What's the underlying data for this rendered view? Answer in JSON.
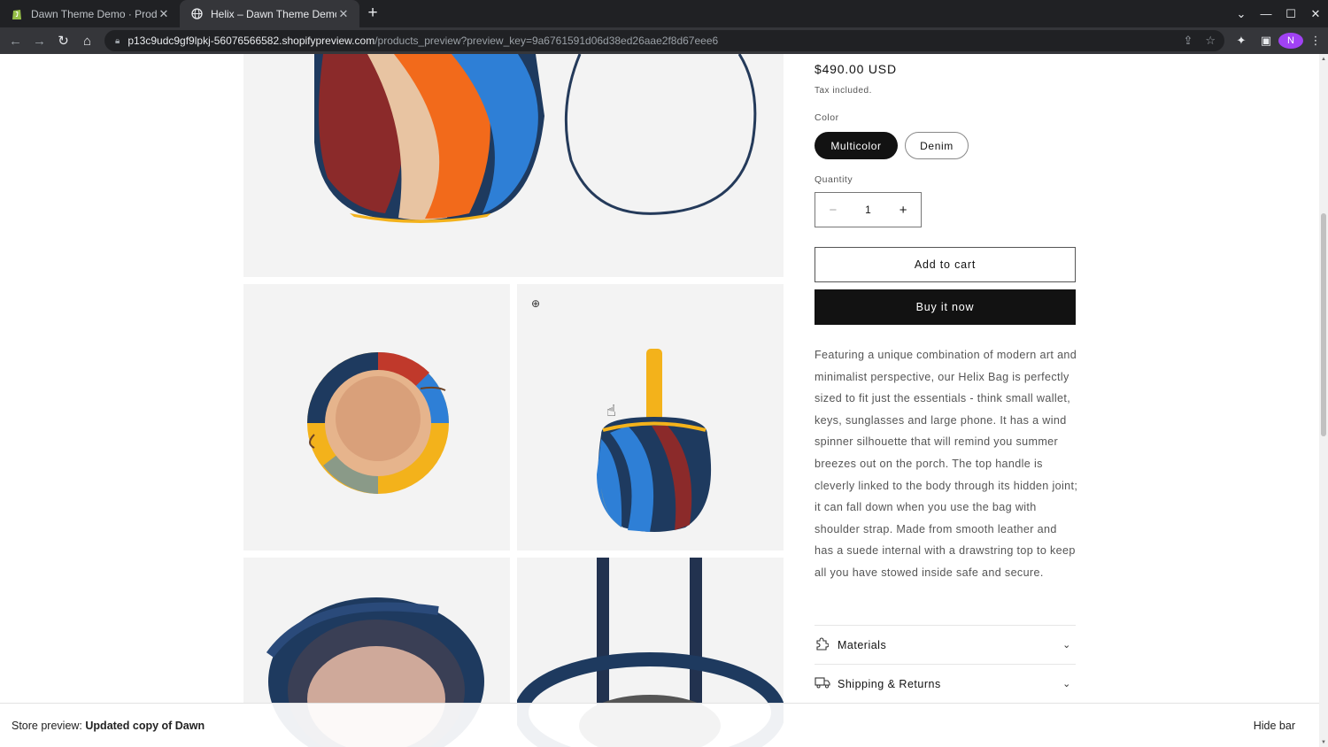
{
  "browser": {
    "tabs": [
      {
        "title": "Dawn Theme Demo · Product",
        "active": false,
        "favicon": "shopify-icon"
      },
      {
        "title": "Helix – Dawn Theme Demo",
        "active": true,
        "favicon": "globe-icon"
      }
    ],
    "url_host": "p13c9udc9gf9lpkj-56076566582.shopifypreview.com",
    "url_path": "/products_preview?preview_key=9a6761591d06d38ed26aae2f8d67eee6",
    "profile_initial": "N"
  },
  "product": {
    "price": "$490.00 USD",
    "tax_note": "Tax included.",
    "color_label": "Color",
    "colors": [
      "Multicolor",
      "Denim"
    ],
    "selected_color": "Multicolor",
    "quantity_label": "Quantity",
    "quantity": "1",
    "add_to_cart": "Add to cart",
    "buy_now": "Buy it now",
    "description": "Featuring a unique combination of modern art and minimalist perspective, our Helix Bag is perfectly sized to fit just the essentials - think small wallet, keys, sunglasses and large phone. It has a wind spinner silhouette that will remind you summer breezes out on the porch. The top handle is cleverly linked to the body through its hidden joint; it can fall down when you use the bag with shoulder strap. Made from smooth leather and has a suede internal with a drawstring top to keep all you have stowed inside safe and secure.",
    "accordions": [
      {
        "label": "Materials",
        "icon": "puzzle-icon"
      },
      {
        "label": "Shipping & Returns",
        "icon": "truck-icon"
      }
    ]
  },
  "preview_bar": {
    "prefix": "Store preview:",
    "theme": "Updated copy of Dawn",
    "hide": "Hide bar"
  },
  "colors": {
    "chrome_dark": "#202124",
    "chrome_mid": "#35363a",
    "button_dark": "#121212",
    "image_bg": "#f3f3f3"
  }
}
